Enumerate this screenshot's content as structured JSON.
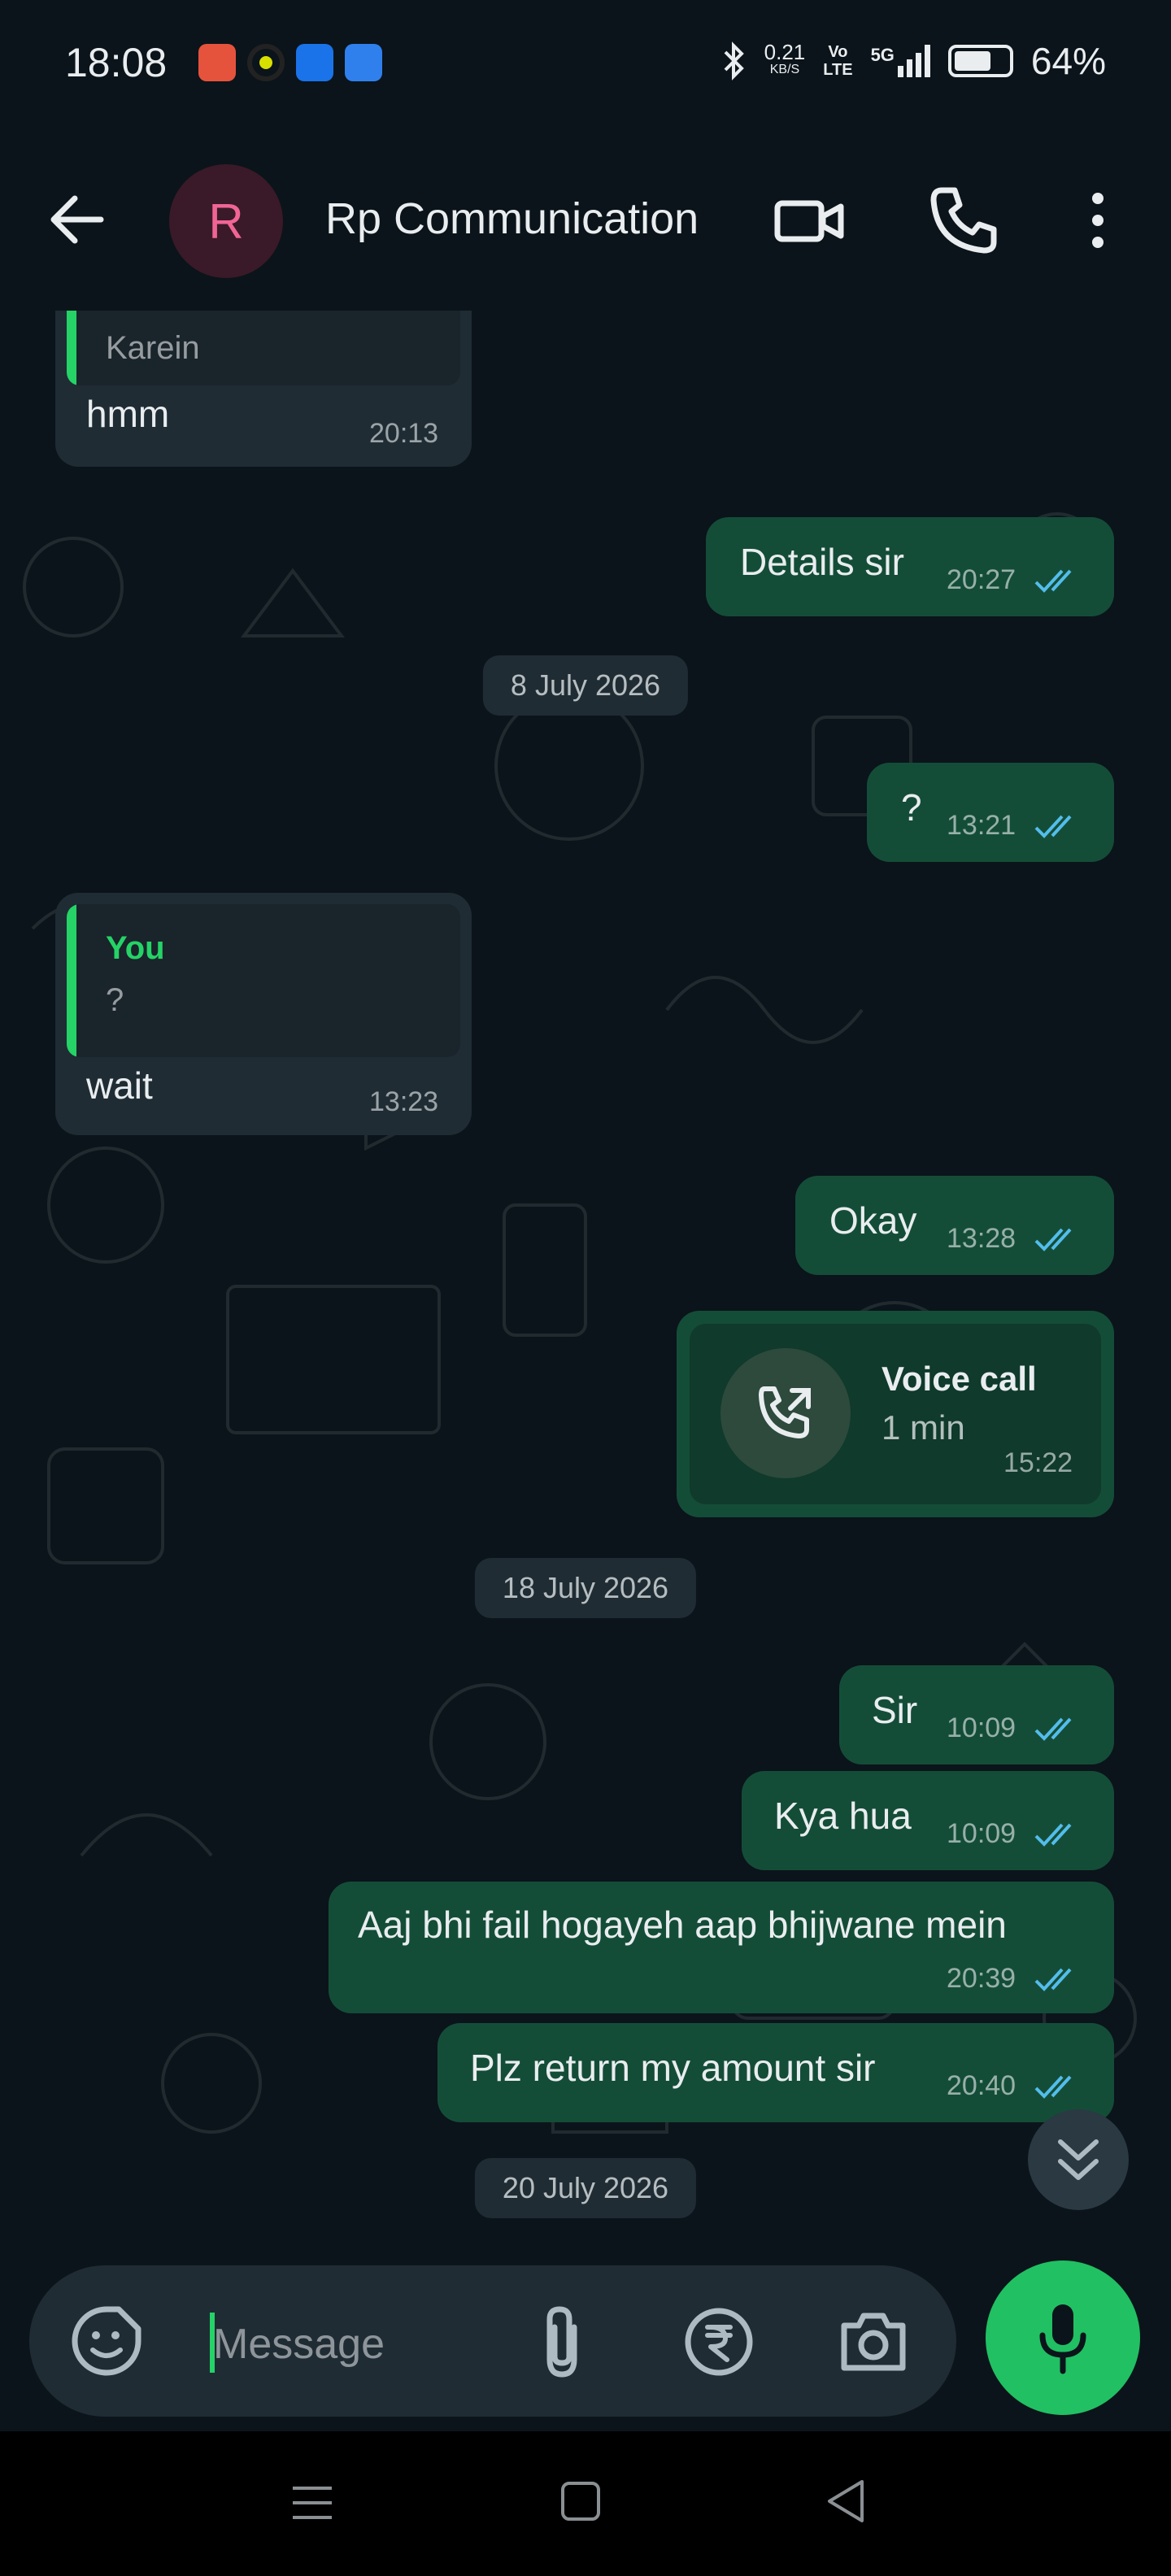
{
  "status_bar": {
    "time": "18:08",
    "net_speed_value": "0.21",
    "net_speed_unit": "KB/S",
    "volte_line1": "Vo",
    "volte_line2": "LTE",
    "network": "5G",
    "battery": "64%"
  },
  "header": {
    "avatar_initial": "R",
    "contact_name": "Rp Communication"
  },
  "messages": [
    {
      "id": "m1",
      "direction": "in",
      "quote_text": "Karein",
      "text": "hmm",
      "time": "20:13"
    },
    {
      "id": "m2",
      "direction": "out",
      "text": "Details sir",
      "time": "20:27",
      "status": "read"
    },
    {
      "id": "d1",
      "type": "date",
      "text": "8 July 2026"
    },
    {
      "id": "m3",
      "direction": "out",
      "text": "?",
      "time": "13:21",
      "status": "read"
    },
    {
      "id": "m4",
      "direction": "in",
      "quote_author": "You",
      "quote_text": "?",
      "text": "wait",
      "time": "13:23"
    },
    {
      "id": "m5",
      "direction": "out",
      "text": "Okay",
      "time": "13:28",
      "status": "read"
    },
    {
      "id": "m6",
      "direction": "out",
      "type": "call",
      "title": "Voice call",
      "subtitle": "1 min",
      "time": "15:22"
    },
    {
      "id": "d2",
      "type": "date",
      "text": "18 July 2026"
    },
    {
      "id": "m7",
      "direction": "out",
      "text": "Sir",
      "time": "10:09",
      "status": "read"
    },
    {
      "id": "m8",
      "direction": "out",
      "text": "Kya hua",
      "time": "10:09",
      "status": "read"
    },
    {
      "id": "m9",
      "direction": "out",
      "text": "Aaj bhi fail hogayeh aap bhijwane mein",
      "time": "20:39",
      "status": "read"
    },
    {
      "id": "m10",
      "direction": "out",
      "text": "Plz return my amount sir",
      "time": "20:40",
      "status": "read"
    },
    {
      "id": "d3",
      "type": "date",
      "text": "20 July 2026"
    }
  ],
  "composer": {
    "placeholder": "Message"
  },
  "colors": {
    "background": "#0b141a",
    "outgoing_bubble": "#144d37",
    "incoming_bubble": "#1f2c34",
    "accent_green": "#25d366",
    "read_tick": "#53bdeb"
  },
  "icons": {
    "back": "arrow-left-icon",
    "video": "video-camera-icon",
    "call": "phone-icon",
    "menu": "more-vertical-icon",
    "emoji": "sticker-emoji-icon",
    "attach": "paperclip-icon",
    "payment": "rupee-icon",
    "camera": "camera-icon",
    "mic": "microphone-icon",
    "scroll": "double-chevron-down-icon"
  }
}
